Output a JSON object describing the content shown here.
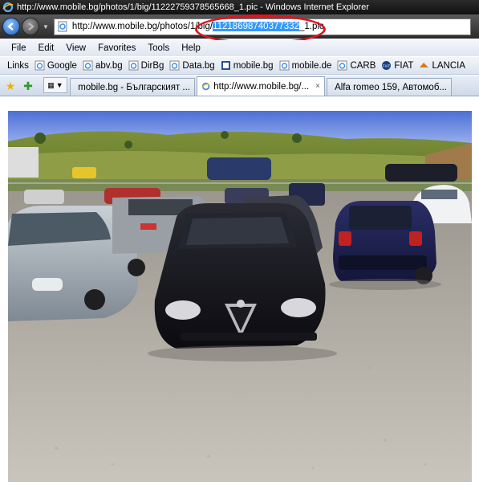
{
  "window": {
    "title": "http://www.mobile.bg/photos/1/big/11222759378565668_1.pic - Windows Internet Explorer"
  },
  "address": {
    "url_prefix": "http://www.mobile.bg/photos/1/big/",
    "url_selected": "11218698740377332",
    "url_suffix": "_1.pic"
  },
  "menu": {
    "items": [
      "File",
      "Edit",
      "View",
      "Favorites",
      "Tools",
      "Help"
    ]
  },
  "links": {
    "label": "Links",
    "items": [
      "Google",
      "abv.bg",
      "DirBg",
      "Data.bg",
      "mobile.bg",
      "mobile.de",
      "CARB",
      "FIAT",
      "LANCIA"
    ]
  },
  "tabs": [
    {
      "label": "mobile.bg - Българският ...",
      "active": false
    },
    {
      "label": "http://www.mobile.bg/...",
      "active": true
    },
    {
      "label": "Alfa romeo 159, Автомоб...",
      "active": false
    }
  ],
  "tab_close_glyph": "×",
  "colors": {
    "highlight": "#3399ff",
    "annotation": "#e0141e"
  }
}
